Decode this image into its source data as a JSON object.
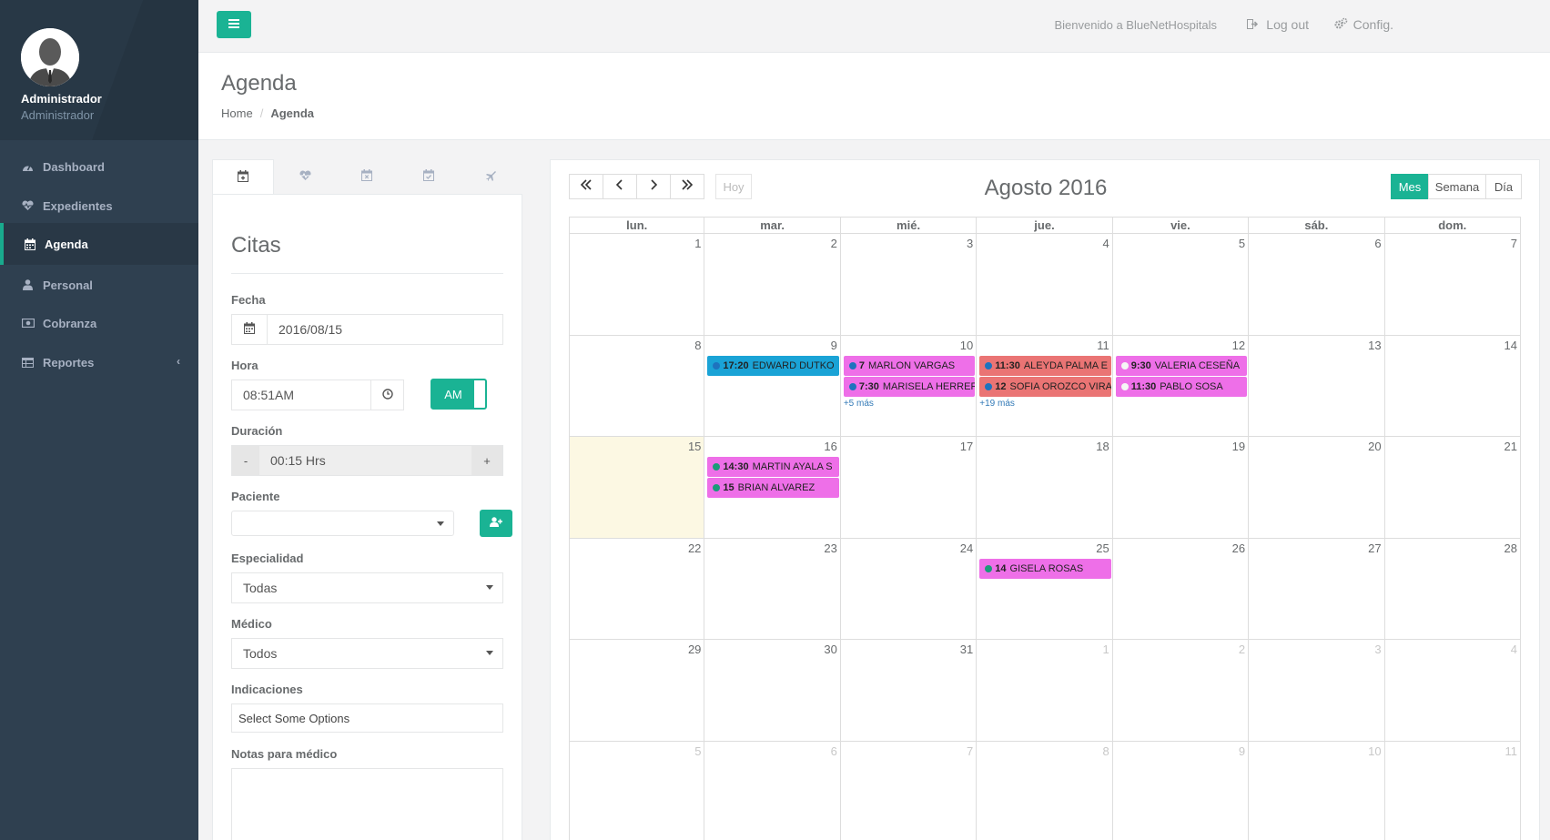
{
  "user": {
    "name": "Administrador",
    "role": "Administrador"
  },
  "nav": [
    {
      "label": "Dashboard",
      "icon": "dashboard-icon"
    },
    {
      "label": "Expedientes",
      "icon": "heartbeat-icon"
    },
    {
      "label": "Agenda",
      "icon": "calendar-icon",
      "active": true
    },
    {
      "label": "Personal",
      "icon": "user-md-icon"
    },
    {
      "label": "Cobranza",
      "icon": "money-icon"
    },
    {
      "label": "Reportes",
      "icon": "table-icon",
      "has_submenu": true
    }
  ],
  "topbar": {
    "welcome": "Bienvenido a BlueNetHospitals",
    "logout": "Log out",
    "config": "Config."
  },
  "page": {
    "title": "Agenda",
    "breadcrumb": {
      "home": "Home",
      "current": "Agenda"
    }
  },
  "form": {
    "tabs": [
      "calendar-plus-icon",
      "heartbeat-icon",
      "calendar-times-icon",
      "calendar-check-icon",
      "plane-icon"
    ],
    "title": "Citas",
    "fecha_label": "Fecha",
    "fecha_value": "2016/08/15",
    "hora_label": "Hora",
    "hora_value": "08:51AM",
    "ampm": "AM",
    "duracion_label": "Duración",
    "duracion_value": "00:15 Hrs",
    "duracion_minus": "-",
    "duracion_plus": "+",
    "paciente_label": "Paciente",
    "paciente_value": "",
    "especialidad_label": "Especialidad",
    "especialidad_value": "Todas",
    "medico_label": "Médico",
    "medico_value": "Todos",
    "indicaciones_label": "Indicaciones",
    "indicaciones_placeholder": "Select Some Options",
    "notas_label": "Notas para médico"
  },
  "calendar": {
    "title": "Agosto 2016",
    "today_button": "Hoy",
    "views": [
      "Mes",
      "Semana",
      "Día"
    ],
    "active_view": "Mes",
    "weekdays": [
      "lun.",
      "mar.",
      "mié.",
      "jue.",
      "vie.",
      "sáb.",
      "dom."
    ],
    "today": {
      "week": 2,
      "day": 0
    },
    "weeks": [
      [
        {
          "n": "1"
        },
        {
          "n": "2"
        },
        {
          "n": "3"
        },
        {
          "n": "4"
        },
        {
          "n": "5"
        },
        {
          "n": "6"
        },
        {
          "n": "7"
        }
      ],
      [
        {
          "n": "8"
        },
        {
          "n": "9"
        },
        {
          "n": "10"
        },
        {
          "n": "11"
        },
        {
          "n": "12"
        },
        {
          "n": "13"
        },
        {
          "n": "14"
        }
      ],
      [
        {
          "n": "15"
        },
        {
          "n": "16"
        },
        {
          "n": "17"
        },
        {
          "n": "18"
        },
        {
          "n": "19"
        },
        {
          "n": "20"
        },
        {
          "n": "21"
        }
      ],
      [
        {
          "n": "22"
        },
        {
          "n": "23"
        },
        {
          "n": "24"
        },
        {
          "n": "25"
        },
        {
          "n": "26"
        },
        {
          "n": "27"
        },
        {
          "n": "28"
        }
      ],
      [
        {
          "n": "29"
        },
        {
          "n": "30"
        },
        {
          "n": "31"
        },
        {
          "n": "1",
          "other": true
        },
        {
          "n": "2",
          "other": true
        },
        {
          "n": "3",
          "other": true
        },
        {
          "n": "4",
          "other": true
        }
      ],
      [
        {
          "n": "5",
          "other": true
        },
        {
          "n": "6",
          "other": true
        },
        {
          "n": "7",
          "other": true
        },
        {
          "n": "8",
          "other": true
        },
        {
          "n": "9",
          "other": true
        },
        {
          "n": "10",
          "other": true
        },
        {
          "n": "11",
          "other": true
        }
      ]
    ],
    "events": [
      {
        "week": 1,
        "day": 1,
        "slot": 0,
        "time": "17:20",
        "title": "EDWARD DUTKO",
        "bg": "#1aa3d6",
        "dot": "#1e73be"
      },
      {
        "week": 1,
        "day": 2,
        "slot": 0,
        "time": "7",
        "title": "MARLON VARGAS",
        "bg": "#ee6fe8",
        "dot": "#1e73be"
      },
      {
        "week": 1,
        "day": 2,
        "slot": 1,
        "time": "7:30",
        "title": "MARISELA HERRERA",
        "bg": "#ee6fe8",
        "dot": "#1e73be"
      },
      {
        "week": 1,
        "day": 3,
        "slot": 0,
        "time": "11:30",
        "title": "ALEYDA PALMA E",
        "bg": "#ea7474",
        "dot": "#1e73be"
      },
      {
        "week": 1,
        "day": 3,
        "slot": 1,
        "time": "12",
        "title": "SOFIA OROZCO VIRAMONTES",
        "bg": "#ea7474",
        "dot": "#1e73be"
      },
      {
        "week": 1,
        "day": 4,
        "slot": 0,
        "time": "9:30",
        "title": "VALERIA CESEÑA",
        "bg": "#ee6fe8",
        "dot": "#f5f5f5"
      },
      {
        "week": 1,
        "day": 4,
        "slot": 1,
        "time": "11:30",
        "title": "PABLO SOSA",
        "bg": "#ee6fe8",
        "dot": "#f5f5f5"
      },
      {
        "week": 2,
        "day": 1,
        "slot": 0,
        "time": "14:30",
        "title": "MARTIN AYALA S",
        "bg": "#ee6fe8",
        "dot": "#1a9b79"
      },
      {
        "week": 2,
        "day": 1,
        "slot": 1,
        "time": "15",
        "title": "BRIAN ALVAREZ",
        "bg": "#ee6fe8",
        "dot": "#1a9b79"
      },
      {
        "week": 3,
        "day": 3,
        "slot": 0,
        "time": "14",
        "title": "GISELA ROSAS",
        "bg": "#ee6fe8",
        "dot": "#1a9b79"
      }
    ],
    "more": [
      {
        "week": 1,
        "day": 2,
        "label": "+5 más"
      },
      {
        "week": 1,
        "day": 3,
        "label": "+19 más"
      }
    ]
  },
  "colors": {
    "accent": "#1ab394",
    "sidebar": "#2f4050",
    "today": "#fcf8e3"
  }
}
